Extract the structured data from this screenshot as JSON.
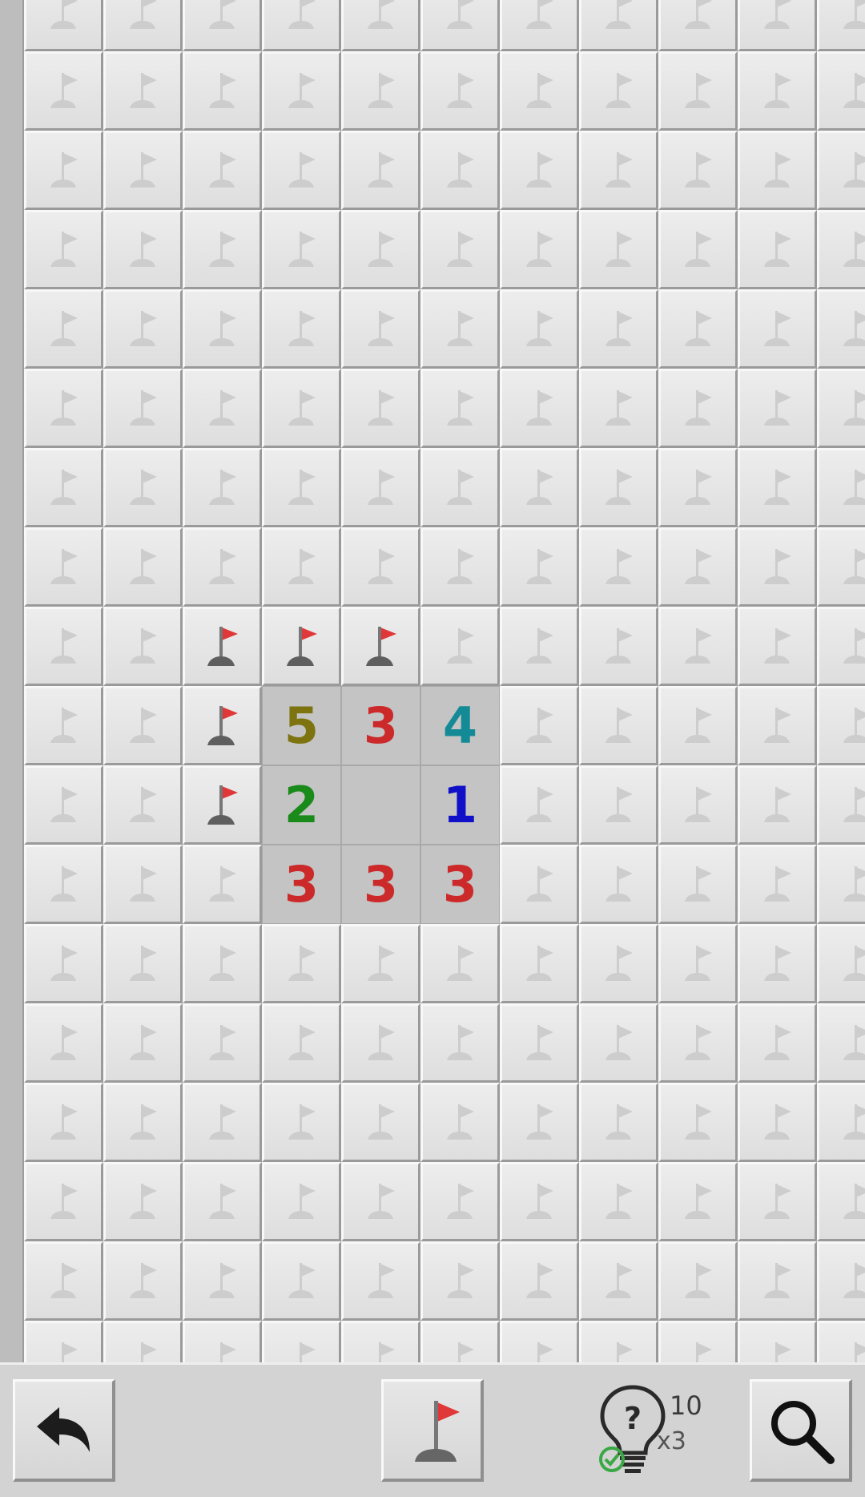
{
  "board": {
    "cols": 13,
    "rows": 18,
    "flags": [
      [
        8,
        2
      ],
      [
        8,
        3
      ],
      [
        8,
        4
      ],
      [
        9,
        2
      ],
      [
        10,
        2
      ]
    ],
    "revealed": [
      {
        "row": 9,
        "col": 3,
        "value": "5"
      },
      {
        "row": 9,
        "col": 4,
        "value": "3"
      },
      {
        "row": 9,
        "col": 5,
        "value": "4"
      },
      {
        "row": 10,
        "col": 3,
        "value": "2"
      },
      {
        "row": 10,
        "col": 4,
        "value": ""
      },
      {
        "row": 10,
        "col": 5,
        "value": "1"
      },
      {
        "row": 11,
        "col": 3,
        "value": "3"
      },
      {
        "row": 11,
        "col": 4,
        "value": "3"
      },
      {
        "row": 11,
        "col": 5,
        "value": "3"
      }
    ]
  },
  "number_colors": {
    "1": "#1010c8",
    "2": "#1a8a1a",
    "3": "#cc2a2a",
    "4": "#138a96",
    "5": "#7d7410"
  },
  "colors": {
    "flag_red": "#e03838",
    "hint_check": "#3aa845"
  },
  "toolbar": {
    "undo_icon": "undo-arrow-icon",
    "flag_mode_icon": "flag-icon",
    "hint_icon": "lightbulb-question-icon",
    "hint_count": "10",
    "hint_multiplier": "x3",
    "zoom_icon": "magnifier-icon"
  }
}
